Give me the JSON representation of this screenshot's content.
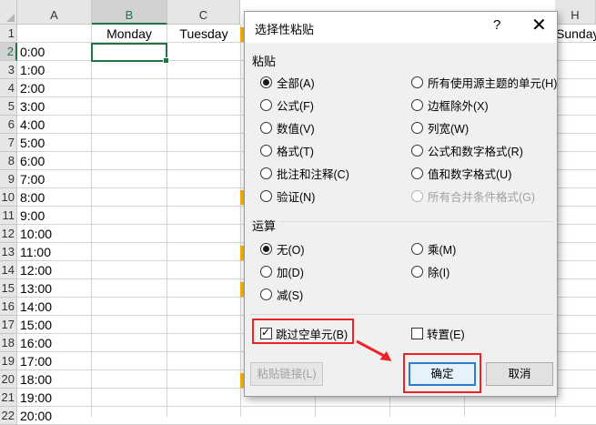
{
  "sheet": {
    "columns": [
      {
        "label": "A",
        "selected": false
      },
      {
        "label": "B",
        "selected": true
      },
      {
        "label": "C",
        "selected": false
      },
      {
        "label": "H",
        "selected": false
      }
    ],
    "rows": [
      "1",
      "2",
      "3",
      "4",
      "5",
      "6",
      "7",
      "8",
      "9",
      "10",
      "11",
      "12",
      "13",
      "14",
      "15",
      "16",
      "17",
      "18",
      "19",
      "20",
      "21",
      "22"
    ],
    "selected_row": "2",
    "header_cells": {
      "b1": "Monday",
      "c1": "Tuesday",
      "h1": "Sunday"
    },
    "times": [
      "0:00",
      "1:00",
      "2:00",
      "3:00",
      "4:00",
      "5:00",
      "6:00",
      "7:00",
      "8:00",
      "9:00",
      "10:00",
      "11:00",
      "12:00",
      "13:00",
      "14:00",
      "15:00",
      "16:00",
      "17:00",
      "18:00",
      "19:00",
      "20:00"
    ],
    "colors": {
      "accent": "#217346",
      "highlight": "#f5b400"
    }
  },
  "dialog": {
    "title": "选择性粘贴",
    "help": "?",
    "close": "✕",
    "paste_group": "粘贴",
    "paste_left": [
      {
        "label": "全部(A)",
        "checked": true,
        "disabled": false
      },
      {
        "label": "公式(F)",
        "checked": false,
        "disabled": false
      },
      {
        "label": "数值(V)",
        "checked": false,
        "disabled": false
      },
      {
        "label": "格式(T)",
        "checked": false,
        "disabled": false
      },
      {
        "label": "批注和注释(C)",
        "checked": false,
        "disabled": false
      },
      {
        "label": "验证(N)",
        "checked": false,
        "disabled": false
      }
    ],
    "paste_right": [
      {
        "label": "所有使用源主题的单元(H)",
        "checked": false,
        "disabled": false
      },
      {
        "label": "边框除外(X)",
        "checked": false,
        "disabled": false
      },
      {
        "label": "列宽(W)",
        "checked": false,
        "disabled": false
      },
      {
        "label": "公式和数字格式(R)",
        "checked": false,
        "disabled": false
      },
      {
        "label": "值和数字格式(U)",
        "checked": false,
        "disabled": false
      },
      {
        "label": "所有合并条件格式(G)",
        "checked": false,
        "disabled": true
      }
    ],
    "operation_group": "运算",
    "op_left": [
      {
        "label": "无(O)",
        "checked": true
      },
      {
        "label": "加(D)",
        "checked": false
      },
      {
        "label": "减(S)",
        "checked": false
      }
    ],
    "op_right": [
      {
        "label": "乘(M)",
        "checked": false
      },
      {
        "label": "除(I)",
        "checked": false
      }
    ],
    "skip_blanks": {
      "label": "跳过空单元(B)",
      "checked": true
    },
    "transpose": {
      "label": "转置(E)",
      "checked": false
    },
    "paste_link": "粘贴链接(L)",
    "ok": "确定",
    "cancel": "取消",
    "annotation_color": "#e8232a"
  }
}
